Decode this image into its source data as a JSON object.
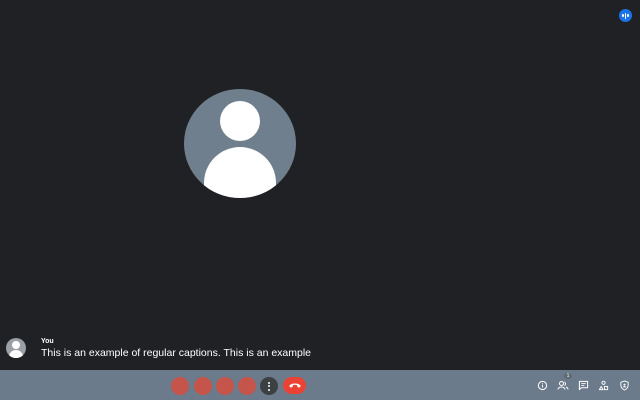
{
  "meeting": {
    "speaking_indicator_icon": "speaking-bars-icon",
    "main_participant": {
      "avatar_icon": "default-person-avatar",
      "avatar_color": "#6f7f8e"
    }
  },
  "caption": {
    "speaker": "You",
    "text": "This is an example of regular captions. This is an example"
  },
  "toolbar": {
    "left_buttons": [
      "mic-button",
      "camera-button",
      "captions-button",
      "present-button"
    ],
    "more_icon": "more-vert-icon",
    "end_call_icon": "call-end-icon",
    "end_call_color": "#ea4335",
    "right_icons": [
      "info-icon",
      "people-icon",
      "chat-icon",
      "activities-icon",
      "host-controls-icon"
    ],
    "people_count": "1"
  },
  "colors": {
    "background": "#202124",
    "toolbar": "#6c7b8c",
    "control_button": "#c5544a",
    "accent": "#1a73e8"
  }
}
